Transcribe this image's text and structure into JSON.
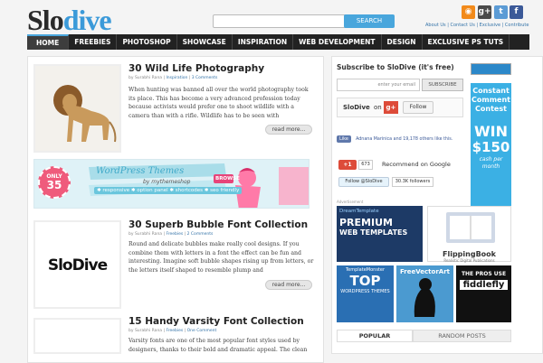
{
  "header": {
    "logo_dark": "Slo",
    "logo_blue": "dive",
    "search_placeholder": "",
    "search_button": "SEARCH",
    "links": "About Us | Contact Us | Exclusive | Contribute"
  },
  "nav": [
    "HOME",
    "FREEBIES",
    "PHOTOSHOP",
    "SHOWCASE",
    "INSPIRATION",
    "WEB DEVELOPMENT",
    "DESIGN",
    "EXCLUSIVE PS TUTS"
  ],
  "posts": [
    {
      "title": "30 Wild Life Photography",
      "author": "by Surabhi Rana",
      "category": "Inspiration",
      "comments": "3 Comments",
      "excerpt": "When hunting was banned all over the world photography took its place. This has become a very advanced profession today because activists would prefer one to shoot wildlife with a camera than with a rifle. Wildlife has to be seen with",
      "more": "read more..."
    },
    {
      "title": "30 Superb Bubble Font Collection",
      "author": "by Surabhi Rana",
      "category": "Freebies",
      "comments": "2 Comments",
      "excerpt": "Round and delicate bubbles make really cool designs. If you combine them with letters in a font the effect can be fun and interesting. Imagine soft bubble shapes rising up from letters, or the letters itself shaped to resemble plump and",
      "more": "read more...",
      "thumb_text": "SloDive"
    },
    {
      "title": "15 Handy Varsity Font Collection",
      "author": "by Surabhi Rana",
      "category": "Freebies",
      "comments": "One Comment",
      "excerpt": "Varsity fonts are one of the most popular font styles used by designers, thanks to their bold and dramatic appeal. The clean"
    }
  ],
  "banner": {
    "badge_top": "ONLY",
    "badge_num": "35",
    "title": "WordPress Themes",
    "by": "by mythemeshop",
    "tags": "✱ responsive ✱ option panel ✱ shortcodes ✱ seo friendly",
    "cta": "BROWSE"
  },
  "sidebar": {
    "subscribe_title": "Subscribe to SloDive (it's free)",
    "email_placeholder": "enter your email",
    "subscribe_button": "SUBSCRIBE",
    "gplus_name": "SloDive",
    "gplus_on": "on",
    "follow": "Follow",
    "like": "Like",
    "like_text": "Adnana Marinica and 19,178 others like this.",
    "gplus_count": "673",
    "recommend": "Recommend on Google",
    "twitter_follow": "Follow @SloDive",
    "twitter_count": "30.3K followers",
    "advertisement": "Advertisement",
    "ad1": {
      "brand": "DreamTemplate",
      "line1": "PREMIUM",
      "line2": "WEB TEMPLATES"
    },
    "ad2": {
      "brand": "FlippingBook",
      "tagline": "Realistic Digital Publications"
    },
    "ad3": {
      "brand": "TemplateMonster",
      "top": "TOP",
      "line": "WORDPRESS THEMES"
    },
    "ad4": {
      "title": "FreeVectorArt"
    },
    "ad5": {
      "line": "THE PROS USE",
      "brand": "fiddlefly"
    },
    "contest": {
      "label": "Constant Comment Contest",
      "win": "WIN",
      "amount": "$150",
      "unit": "cash per month"
    },
    "tabs": [
      "POPULAR",
      "RANDOM POSTS"
    ]
  }
}
